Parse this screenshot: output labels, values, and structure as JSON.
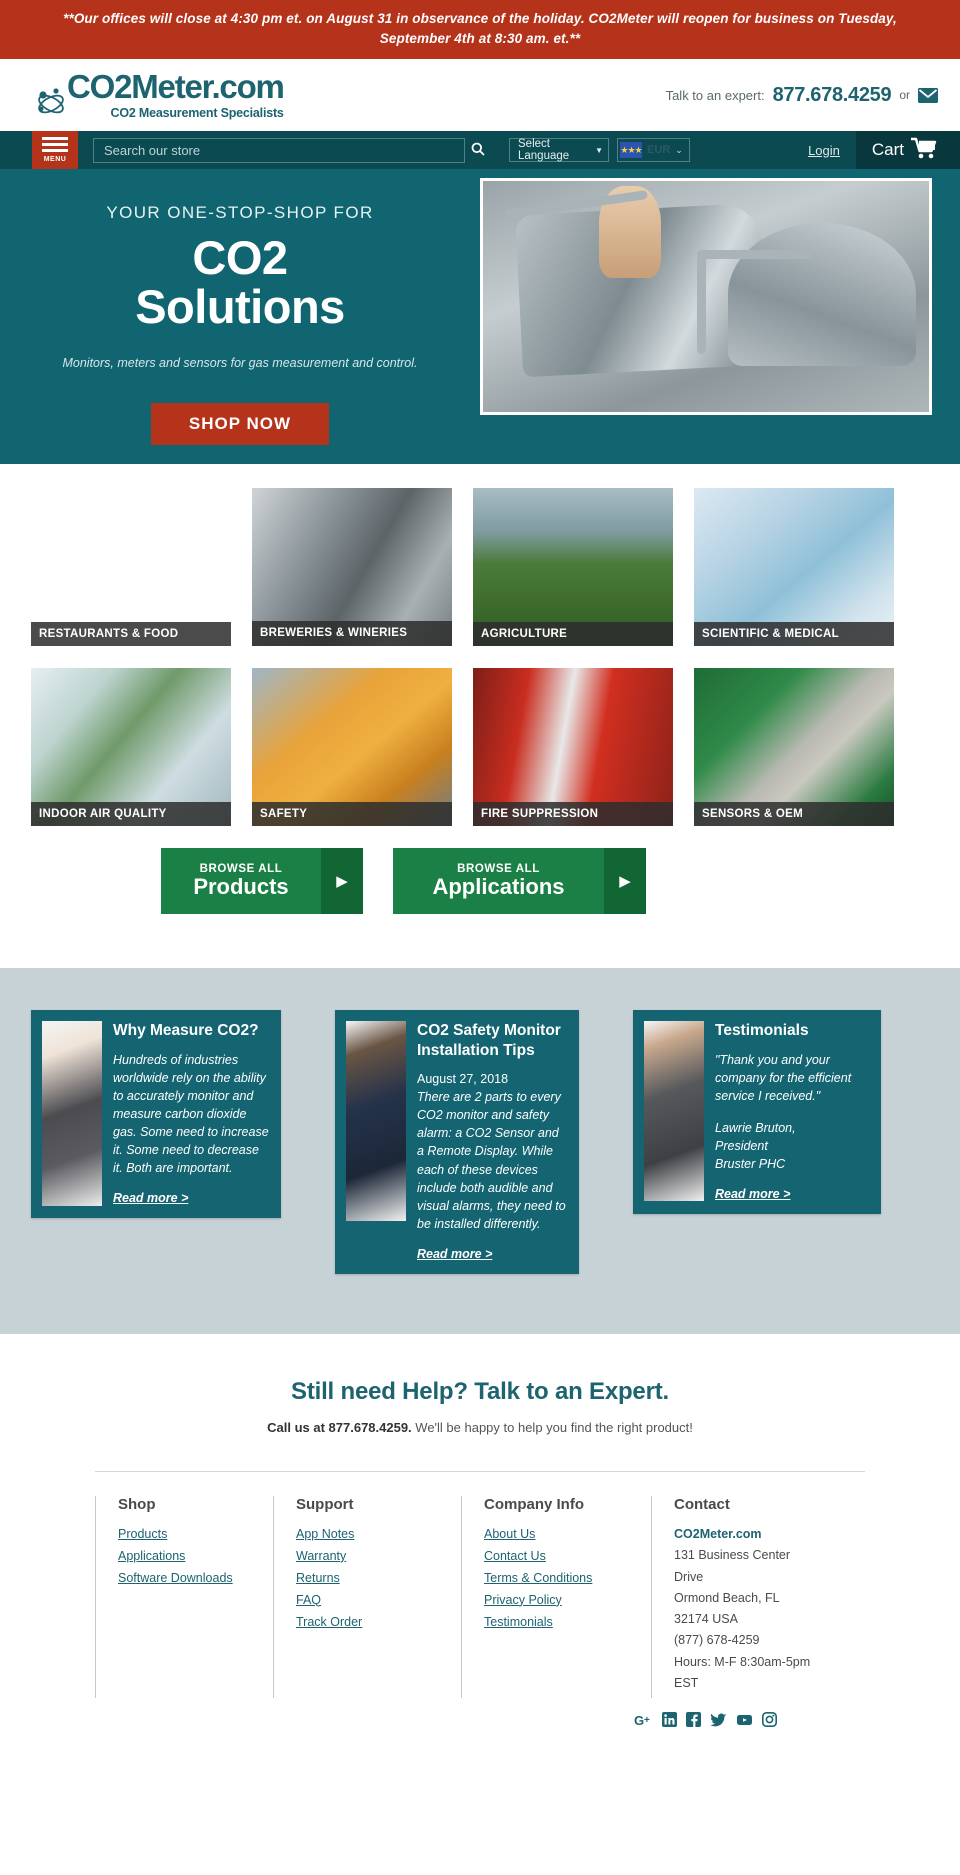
{
  "announcement": "**Our offices will close at 4:30 pm et. on August 31 in observance of the holiday. CO2Meter will reopen for business on Tuesday, September 4th at 8:30 am. et.**",
  "masthead": {
    "logo_text": "CO2Meter.com",
    "logo_tagline": "CO2 Measurement Specialists",
    "expert_label": "Talk to an expert:",
    "expert_phone": "877.678.4259",
    "or_label": "or",
    "email_icon": "envelope-icon"
  },
  "utilbar": {
    "menu_label": "MENU",
    "search_placeholder": "Search our store",
    "search_value": "",
    "search_icon": "search-icon",
    "language_selected": "Select Language",
    "currency_selected": "EUR",
    "currency_flag": "eu-flag-icon",
    "login_label": "Login",
    "cart_label": "Cart",
    "cart_icon": "cart-icon"
  },
  "hero": {
    "kicker": "YOUR ONE-STOP-SHOP FOR",
    "title_line1": "CO2",
    "title_line2": "Solutions",
    "subtitle": "Monitors, meters and sensors for gas measurement and control.",
    "cta": "SHOP NOW",
    "image_alt": "brewery-tank-closeup-photo"
  },
  "tiles": [
    {
      "label": "RESTAURANTS & FOOD",
      "photo": "ph-restaurant"
    },
    {
      "label": "BREWERIES & WINERIES",
      "photo": "ph-brewery"
    },
    {
      "label": "AGRICULTURE",
      "photo": "ph-agri"
    },
    {
      "label": "SCIENTIFIC & MEDICAL",
      "photo": "ph-sci"
    },
    {
      "label": "INDOOR AIR QUALITY",
      "photo": "ph-indoor"
    },
    {
      "label": "SAFETY",
      "photo": "ph-safety"
    },
    {
      "label": "FIRE SUPPRESSION",
      "photo": "ph-fire"
    },
    {
      "label": "SENSORS & OEM",
      "photo": "ph-sensor"
    }
  ],
  "browse": {
    "products_small": "BROWSE ALL",
    "products_big": "Products",
    "applications_small": "BROWSE ALL",
    "applications_big": "Applications",
    "arrow_icon": "chevron-right-icon"
  },
  "cards": [
    {
      "title": "Why Measure CO2?",
      "body": "Hundreds of industries worldwide rely on the ability to accurately monitor and measure carbon dioxide gas. Some need to increase it. Some need to decrease it. Both are important.",
      "link": "Read more >"
    },
    {
      "title": "CO2 Safety Monitor Installation Tips",
      "date": "August 27, 2018",
      "body": "There are 2 parts to every CO2 monitor and safety alarm: a CO2 Sensor and a Remote Display. While each of these devices include both audible and visual alarms, they need to be installed differently.",
      "link": "Read more >"
    },
    {
      "title": "Testimonials",
      "body": "\"Thank you and your company for the efficient service I received.\"",
      "signature_name": "Lawrie Bruton,",
      "signature_role": "President",
      "signature_company": "Bruster PHC",
      "link": "Read more >"
    }
  ],
  "help": {
    "title": "Still need Help? Talk to an Expert.",
    "call_bold": "Call us at 877.678.4259.",
    "call_rest": " We'll be happy to help you find the right product!"
  },
  "footer": {
    "shop": {
      "heading": "Shop",
      "links": [
        "Products",
        "Applications",
        "Software Downloads"
      ]
    },
    "support": {
      "heading": "Support",
      "links": [
        "App Notes",
        "Warranty",
        "Returns",
        "FAQ",
        "Track Order"
      ]
    },
    "company": {
      "heading": "Company Info",
      "links": [
        "About Us",
        "Contact Us",
        "Terms & Conditions",
        "Privacy Policy",
        "Testimonials"
      ]
    },
    "contact": {
      "heading": "Contact",
      "name": "CO2Meter.com",
      "lines": [
        "131 Business Center",
        "Drive",
        "Ormond Beach, FL",
        "32174 USA",
        "(877) 678-4259",
        "Hours: M-F 8:30am-5pm",
        "EST"
      ]
    },
    "social": [
      "google-plus-icon",
      "linkedin-icon",
      "facebook-icon",
      "twitter-icon",
      "youtube-icon",
      "instagram-icon"
    ]
  },
  "colors": {
    "announce_red": "#b5321b",
    "brand_teal": "#1d6370",
    "hero_teal": "#106571",
    "utilbar_teal": "#0c4a52",
    "green": "#1a8045",
    "grey_band": "#c7d2d6"
  }
}
